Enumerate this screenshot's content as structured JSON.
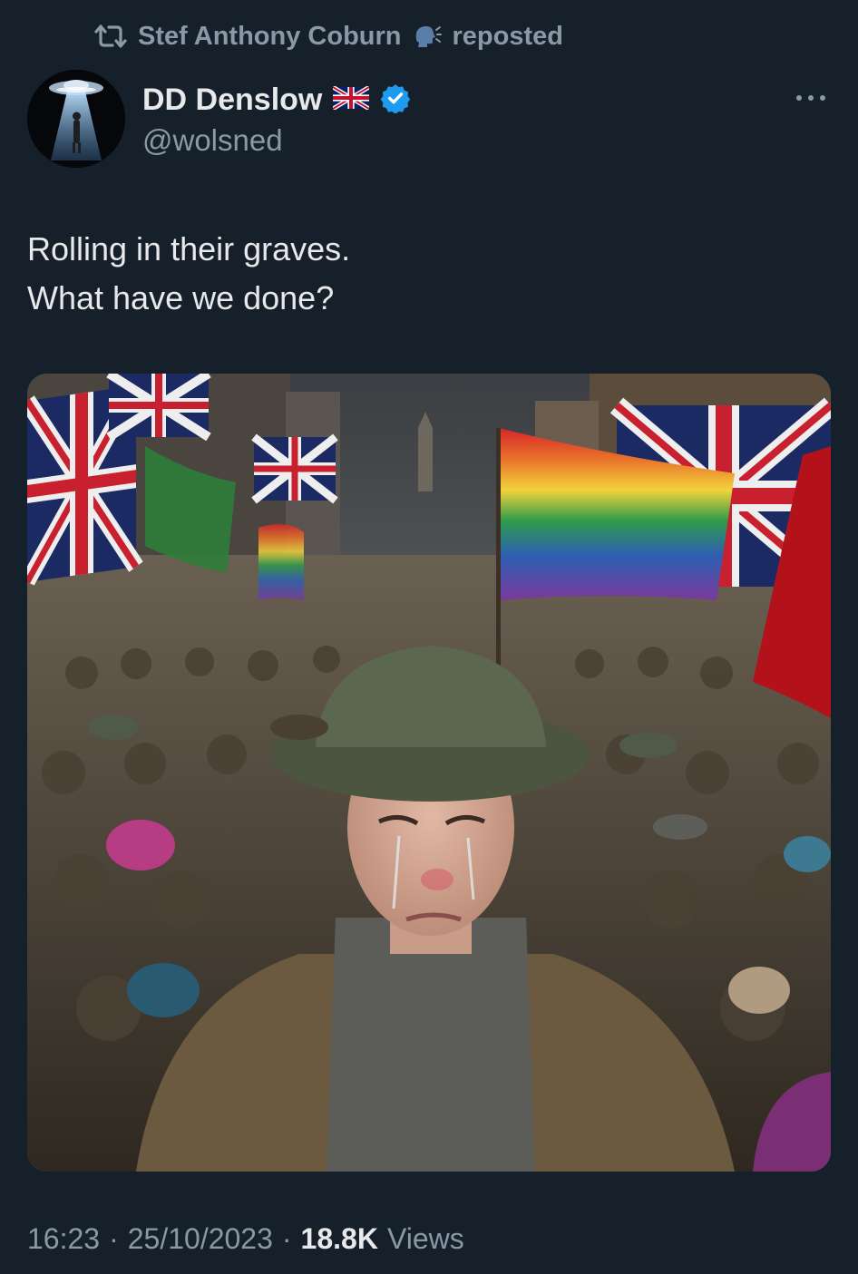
{
  "repost": {
    "user": "Stef Anthony Coburn",
    "label": "reposted",
    "icon": "repost-icon"
  },
  "author": {
    "display_name": "DD Denslow",
    "handle": "@wolsned",
    "flag_icon": "union-jack-flag-icon",
    "verified_icon": "verified-badge-icon"
  },
  "tweet": {
    "line1": "Rolling in their graves.",
    "line2": "What have we done?"
  },
  "media": {
    "description_icon": "ai-generated-image-crying-soldier-crowd-flags"
  },
  "meta": {
    "time": "16:23",
    "sep1": "·",
    "date": "25/10/2023",
    "sep2": "·",
    "views_count": "18.8K",
    "views_label": "Views"
  },
  "colors": {
    "background": "#15202b",
    "primary_text": "#e7e9ea",
    "secondary_text": "#8b98a5",
    "verified_blue": "#1d9bf0"
  }
}
